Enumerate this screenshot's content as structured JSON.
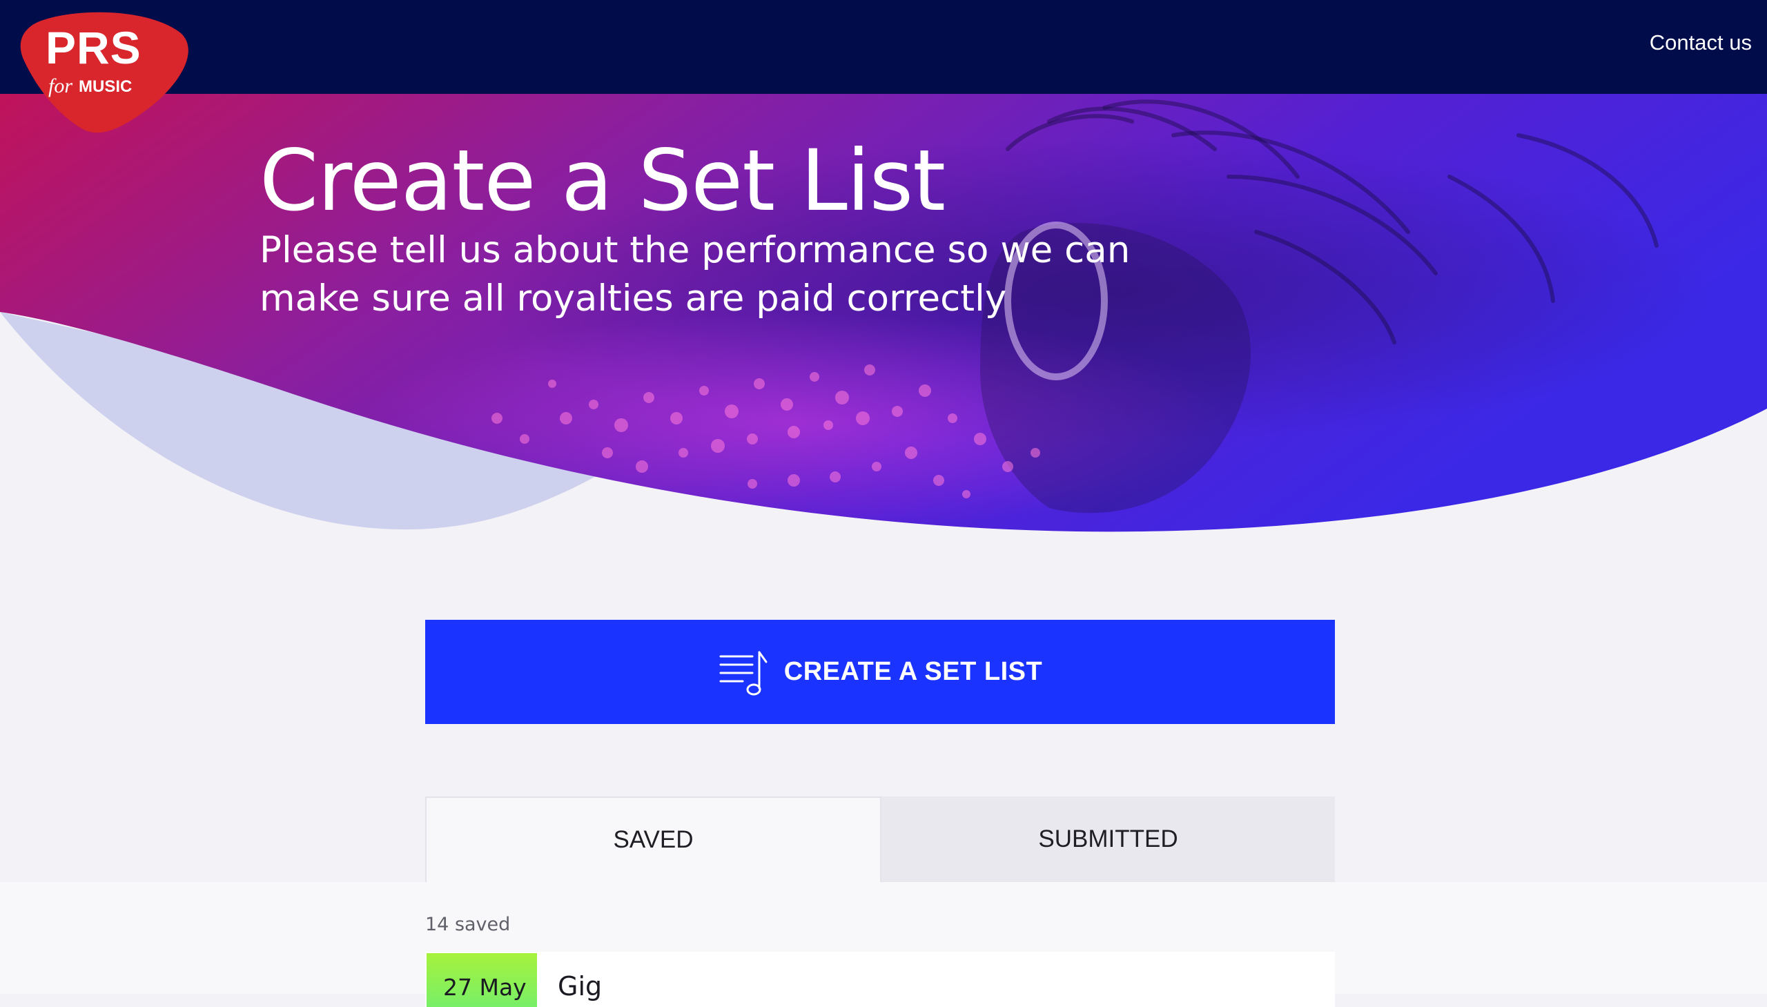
{
  "header": {
    "logo": {
      "primary": "PRS",
      "secondary_for": "for",
      "secondary_music": "MUSIC"
    },
    "contact_label": "Contact us",
    "background_color": "#010c4b"
  },
  "hero": {
    "title": "Create a Set List",
    "subtitle": "Please tell us about the performance so we can make sure all royalties are paid correctly",
    "gradient_colors": [
      "#c0135a",
      "#8a1fa0",
      "#3b1fe0"
    ]
  },
  "create_button": {
    "label": "CREATE A SET LIST",
    "icon": "music-list-icon",
    "color": "#1a33ff"
  },
  "tabs": [
    {
      "label": "SAVED",
      "active": true
    },
    {
      "label": "SUBMITTED",
      "active": false
    }
  ],
  "saved_list": {
    "count_text": "14 saved",
    "items": [
      {
        "date": "27 May",
        "title": "Gig"
      }
    ]
  }
}
